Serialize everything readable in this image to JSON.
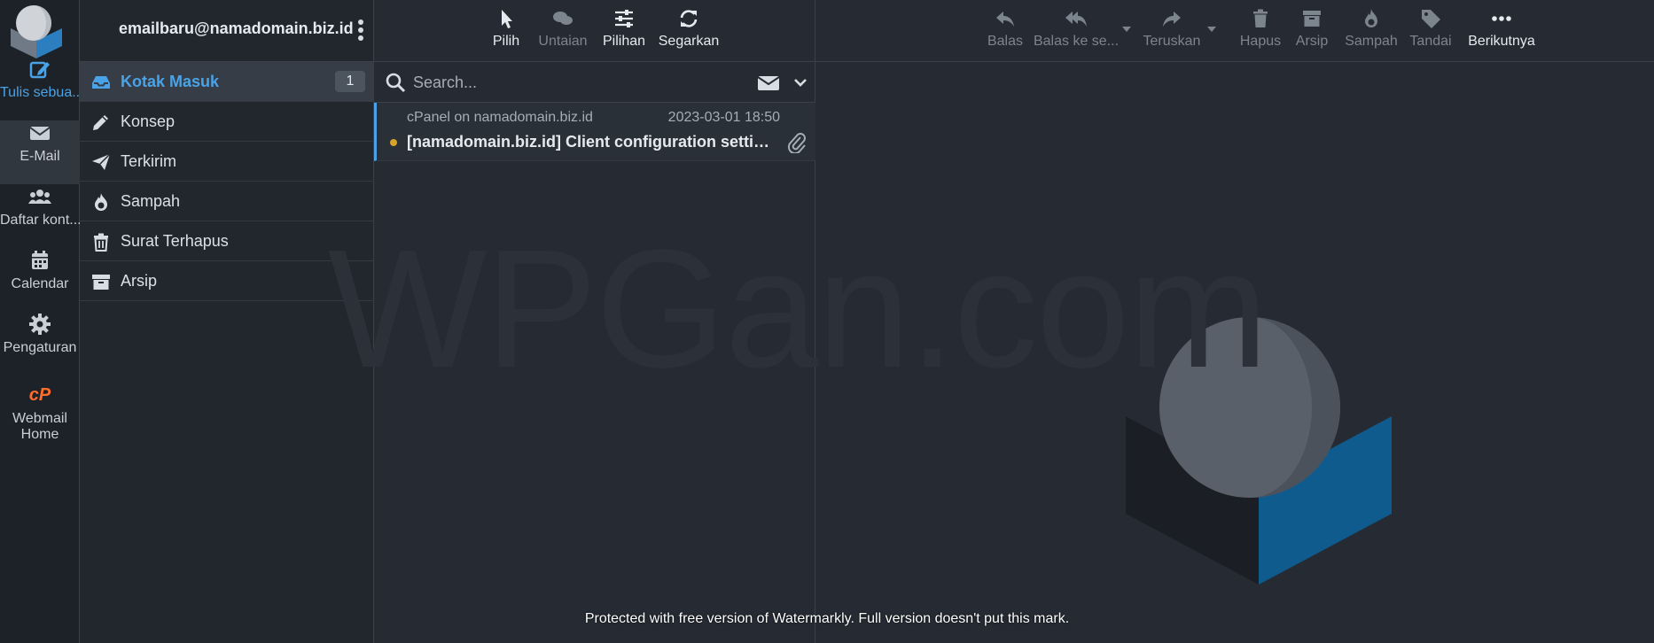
{
  "account": {
    "email": "emailbaru@namadomain.biz.id"
  },
  "rail": {
    "compose": "Tulis sebua...",
    "email": "E-Mail",
    "contacts": "Daftar kont...",
    "calendar": "Calendar",
    "settings": "Pengaturan",
    "webmail_home": "Webmail Home"
  },
  "folders": [
    {
      "name": "Kotak Masuk",
      "icon": "inbox-icon",
      "unread": "1",
      "selected": true
    },
    {
      "name": "Konsep",
      "icon": "pencil-icon"
    },
    {
      "name": "Terkirim",
      "icon": "paper-plane-icon"
    },
    {
      "name": "Sampah",
      "icon": "fire-icon"
    },
    {
      "name": "Surat Terhapus",
      "icon": "trash-icon"
    },
    {
      "name": "Arsip",
      "icon": "archive-icon"
    }
  ],
  "list_toolbar": {
    "select": "Pilih",
    "threads": "Untaian",
    "options": "Pilihan",
    "refresh": "Segarkan"
  },
  "search": {
    "placeholder": "Search..."
  },
  "messages": [
    {
      "from": "cPanel on namadomain.biz.id",
      "date": "2023-03-01 18:50",
      "subject": "[namadomain.biz.id] Client configuration settings f...",
      "unread": true,
      "attachment": true
    }
  ],
  "message_toolbar": {
    "reply": "Balas",
    "reply_all": "Balas ke se...",
    "forward": "Teruskan",
    "delete": "Hapus",
    "archive": "Arsip",
    "junk": "Sampah",
    "mark": "Tandai",
    "more": "Berikutnya"
  },
  "watermark": {
    "text": "WPGan.com",
    "note": "Protected with free version of Watermarkly. Full version doesn't put this mark."
  },
  "colors": {
    "accent": "#4aa3e6",
    "unread_dot": "#d7a32a",
    "cpanel_orange": "#ff6c2c",
    "logo_blue": "#0f5b8e"
  }
}
